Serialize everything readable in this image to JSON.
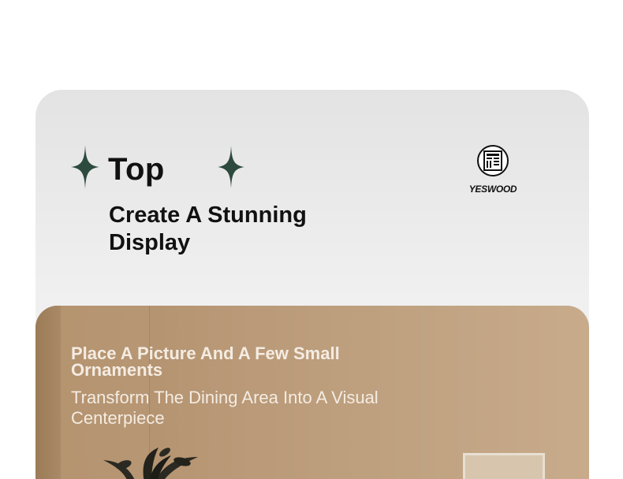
{
  "hero": {
    "headline": "Top",
    "subheadline": "Create A Stunning Display",
    "accent_color": "#2d4a3e"
  },
  "brand": {
    "logo_icon": "wardrobe-icon",
    "name": "YESWOOD"
  },
  "photo": {
    "title": "Place A Picture And A Few Small Ornaments",
    "description": "Transform The Dining Area Into A Visual Centerpiece"
  }
}
